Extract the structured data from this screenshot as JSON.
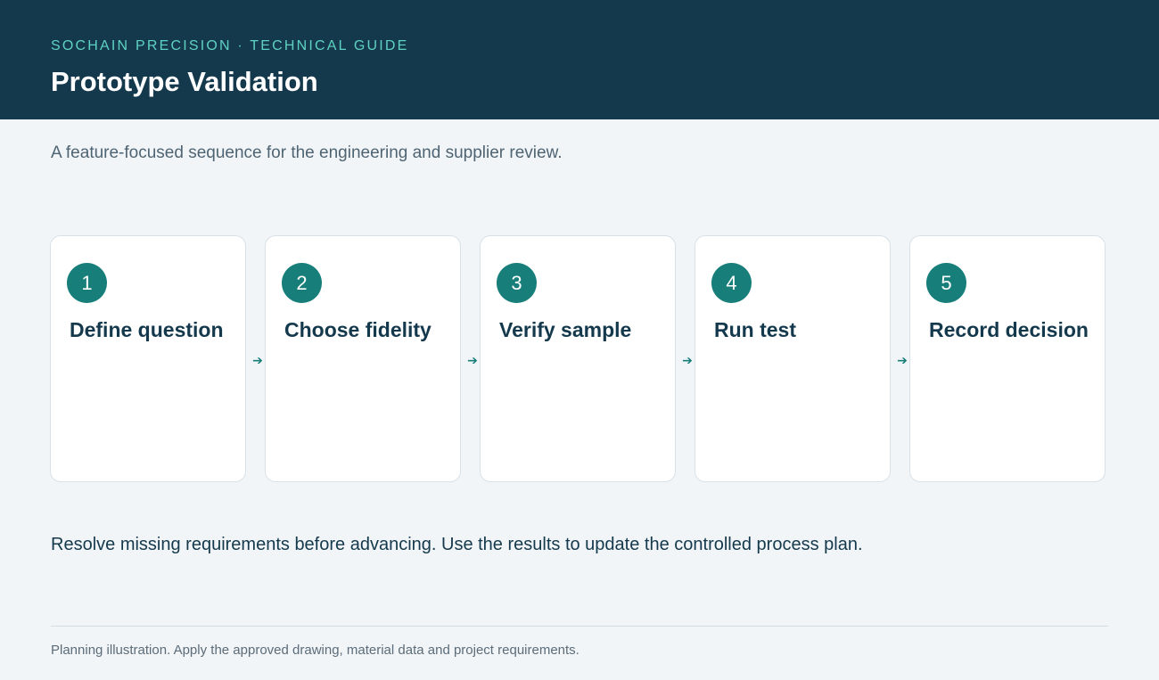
{
  "header": {
    "eyebrow": "SOCHAIN PRECISION · TECHNICAL GUIDE",
    "title": "Prototype Validation",
    "background": "#15394c",
    "accent": "#5ed2c2"
  },
  "subtitle": "A feature-focused sequence for the engineering and supplier review.",
  "steps": [
    {
      "number": "1",
      "label": "Define question"
    },
    {
      "number": "2",
      "label": "Choose fidelity"
    },
    {
      "number": "3",
      "label": "Verify sample"
    },
    {
      "number": "4",
      "label": "Run test"
    },
    {
      "number": "5",
      "label": "Record decision"
    }
  ],
  "arrow_icon": "arrow-right-icon",
  "step_color": "#177e7a",
  "note": "Resolve missing requirements before advancing. Use the results to update the controlled process plan.",
  "footer": "Planning illustration. Apply the approved drawing, material data and project requirements."
}
